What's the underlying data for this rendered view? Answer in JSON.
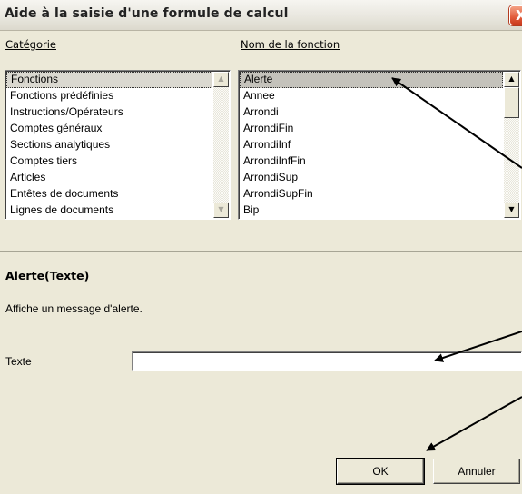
{
  "window": {
    "title": "Aide à la saisie d'une formule de calcul",
    "close_label": "X"
  },
  "categorie": {
    "label": "Catégorie",
    "items": [
      "Fonctions",
      "Fonctions prédéfinies",
      "Instructions/Opérateurs",
      "Comptes généraux",
      "Sections analytiques",
      "Comptes tiers",
      "Articles",
      "Entêtes de documents",
      "Lignes de documents"
    ]
  },
  "fonction": {
    "label": "Nom de la fonction",
    "items": [
      "Alerte",
      "Annee",
      "Arrondi",
      "ArrondiFin",
      "ArrondiInf",
      "ArrondiInfFin",
      "ArrondiSup",
      "ArrondiSupFin",
      "Bip"
    ]
  },
  "detail": {
    "signature": "Alerte(Texte)",
    "description": "Affiche un message d'alerte.",
    "param_label": "Texte",
    "param_value": ""
  },
  "buttons": {
    "ok": "OK",
    "cancel": "Annuler"
  },
  "icons": {
    "scroll_up": "triangle-up-icon",
    "scroll_down": "triangle-down-icon",
    "close": "close-icon"
  }
}
